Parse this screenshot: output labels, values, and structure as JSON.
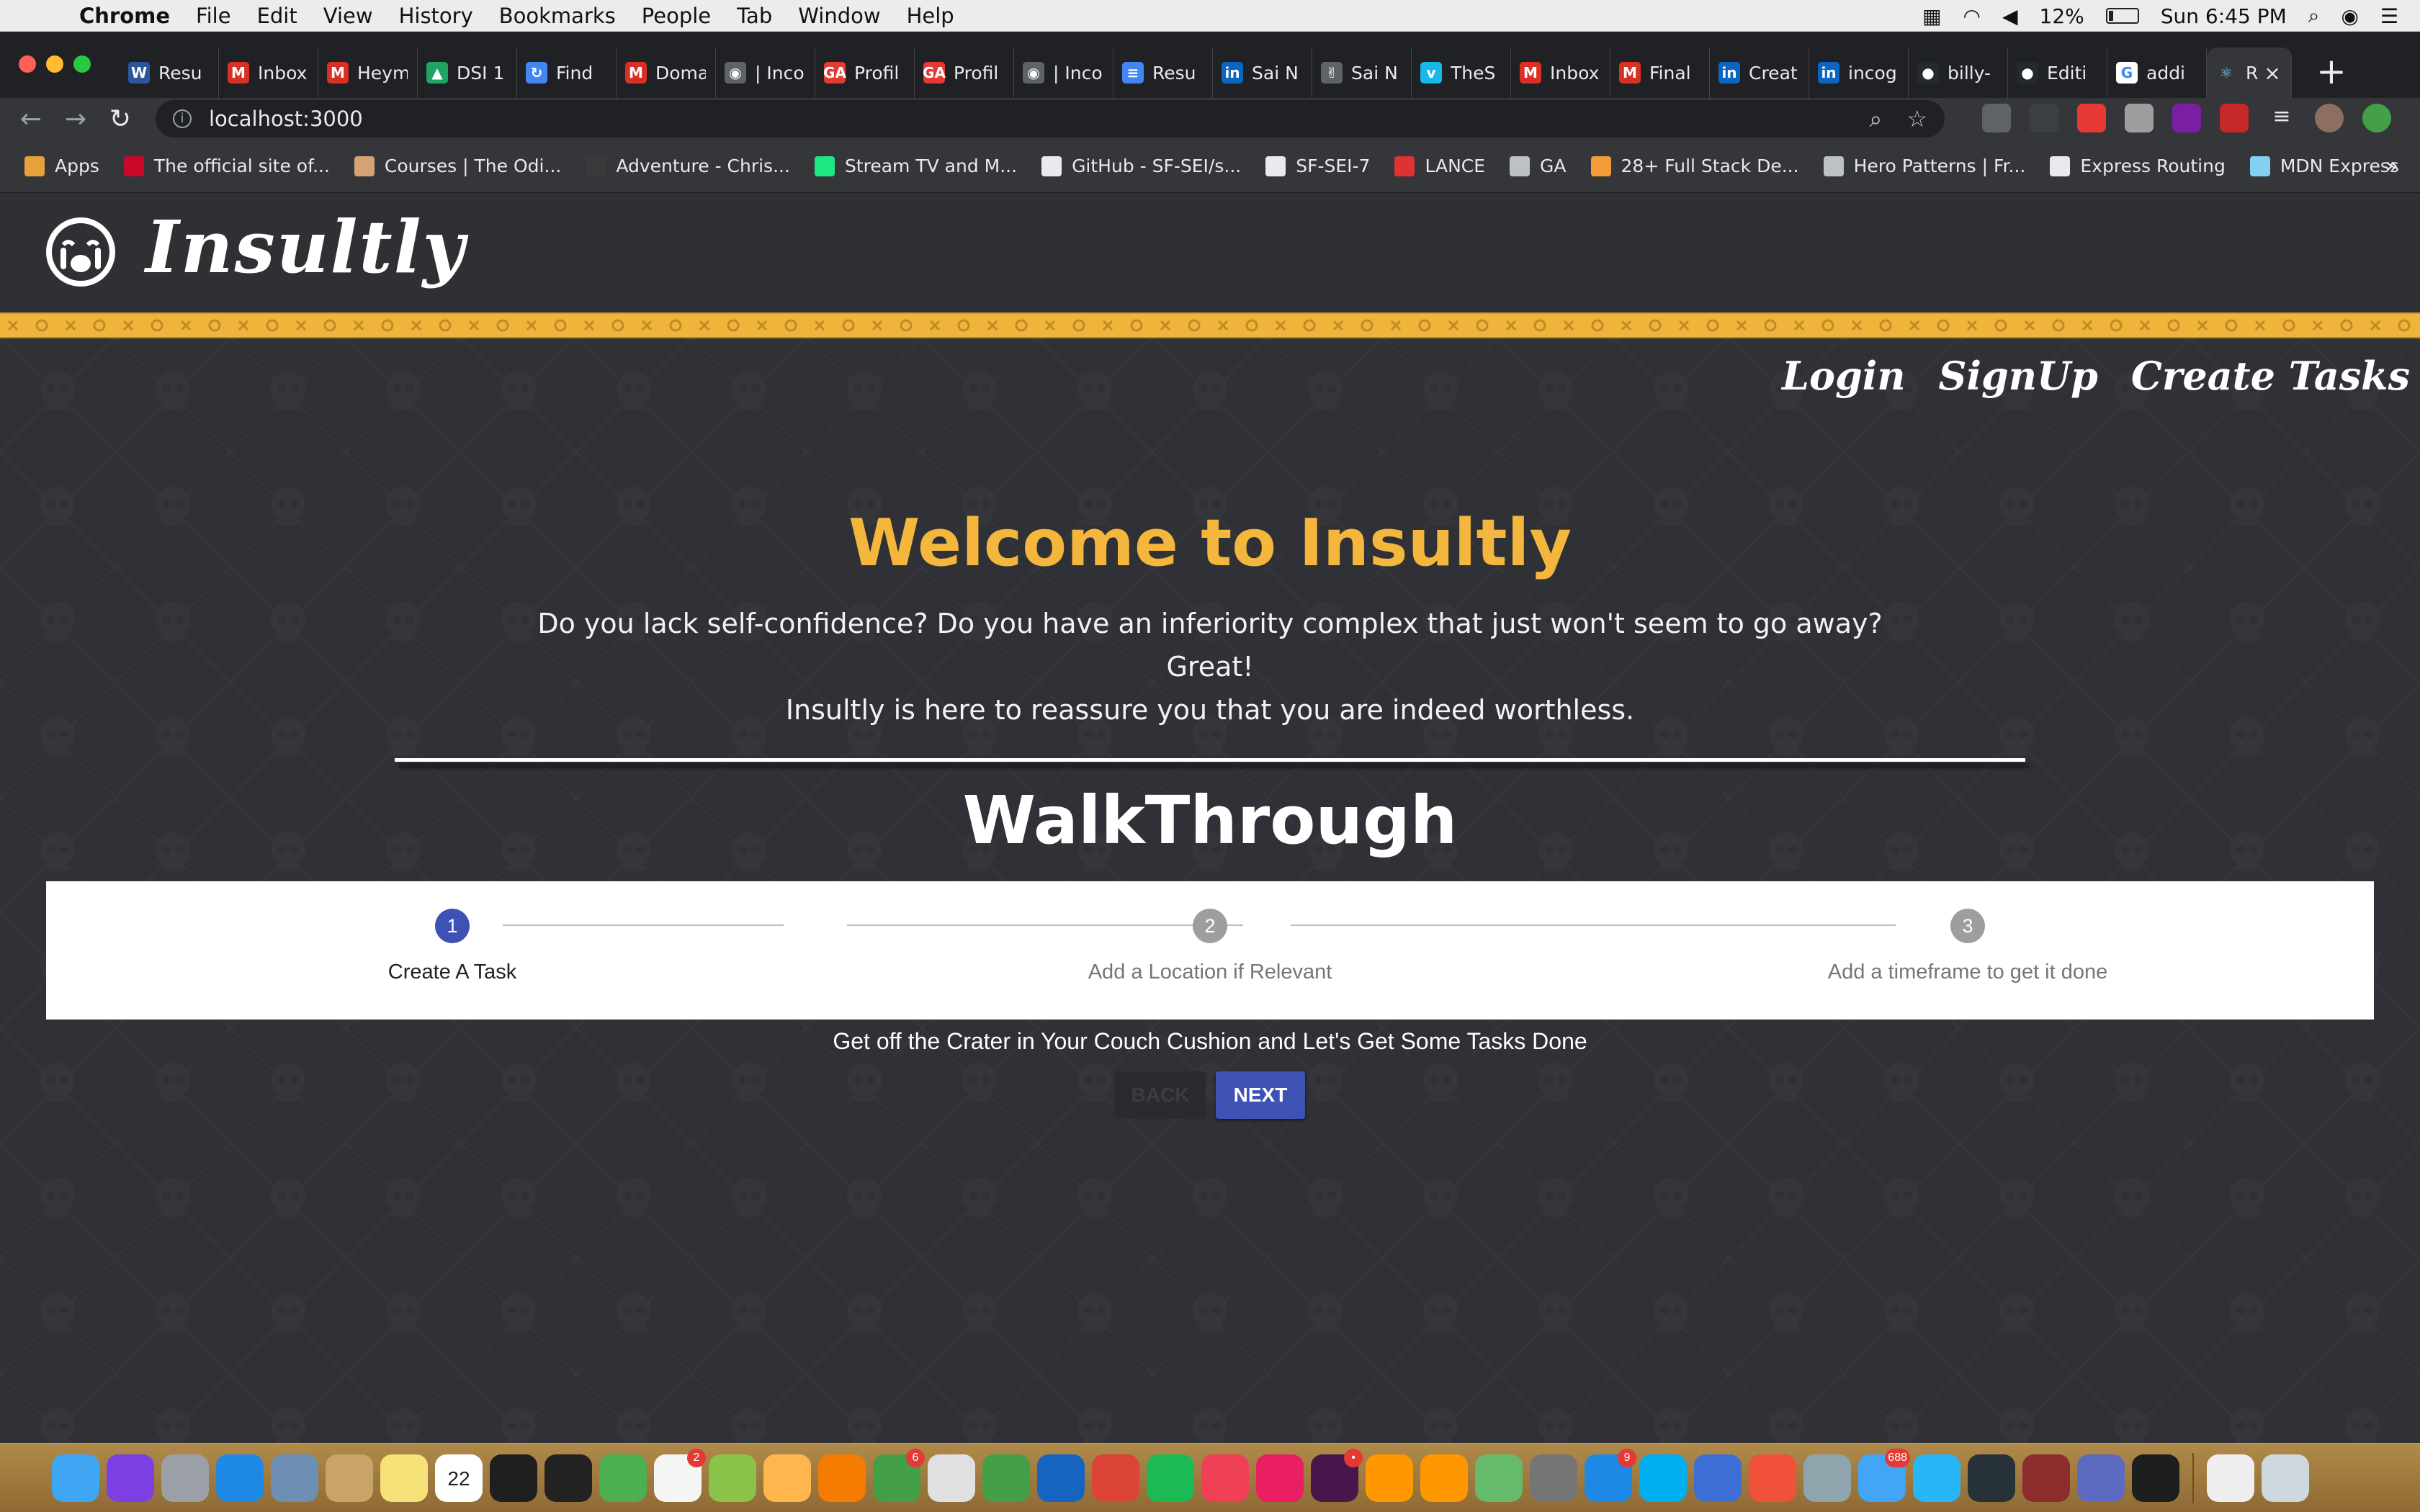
{
  "menubar": {
    "app": "Chrome",
    "items": [
      "File",
      "Edit",
      "View",
      "History",
      "Bookmarks",
      "People",
      "Tab",
      "Window",
      "Help"
    ],
    "battery": "12%",
    "clock": "Sun 6:45 PM"
  },
  "tabs": [
    {
      "title": "Resu",
      "icon": "word-doc-icon",
      "color": "#2b579a",
      "glyph": "W"
    },
    {
      "title": "Inbox",
      "icon": "gmail-icon",
      "color": "#d93025",
      "glyph": "M"
    },
    {
      "title": "Heym",
      "icon": "gmail-icon",
      "color": "#d93025",
      "glyph": "M"
    },
    {
      "title": "DSI 1",
      "icon": "google-drive-icon",
      "color": "#1fa463",
      "glyph": "▲"
    },
    {
      "title": "Find",
      "icon": "loading-spinner-icon",
      "color": "#4285f4",
      "glyph": "↻"
    },
    {
      "title": "Doma",
      "icon": "gmail-icon",
      "color": "#d93025",
      "glyph": "M"
    },
    {
      "title": "| Inco",
      "icon": "incognito-icon",
      "color": "#5f6368",
      "glyph": "◉"
    },
    {
      "title": "Profil",
      "icon": "ga-icon",
      "color": "#e53935",
      "glyph": "GA"
    },
    {
      "title": "Profil",
      "icon": "ga-icon",
      "color": "#e53935",
      "glyph": "GA"
    },
    {
      "title": "| Inco",
      "icon": "incognito-icon",
      "color": "#5f6368",
      "glyph": "◉"
    },
    {
      "title": "Resu",
      "icon": "google-docs-icon",
      "color": "#4285f4",
      "glyph": "≡"
    },
    {
      "title": "Sai N",
      "icon": "linkedin-icon",
      "color": "#0a66c2",
      "glyph": "in"
    },
    {
      "title": "Sai N",
      "icon": "hand-icon",
      "color": "#5f6368",
      "glyph": "✌"
    },
    {
      "title": "TheS",
      "icon": "vimeo-icon",
      "color": "#1ab7ea",
      "glyph": "v"
    },
    {
      "title": "Inbox",
      "icon": "gmail-icon",
      "color": "#d93025",
      "glyph": "M"
    },
    {
      "title": "Final",
      "icon": "gmail-icon",
      "color": "#d93025",
      "glyph": "M"
    },
    {
      "title": "Creat",
      "icon": "linkedin-icon",
      "color": "#0a66c2",
      "glyph": "in"
    },
    {
      "title": "incog",
      "icon": "linkedin-icon",
      "color": "#0a66c2",
      "glyph": "in"
    },
    {
      "title": "billy-",
      "icon": "github-icon",
      "color": "#24292e",
      "glyph": "●"
    },
    {
      "title": "Editi",
      "icon": "github-icon",
      "color": "#24292e",
      "glyph": "●"
    },
    {
      "title": "addi",
      "icon": "google-icon",
      "color": "#ffffff",
      "glyph": "G"
    }
  ],
  "active_tab": {
    "title": "R",
    "icon": "react-icon",
    "color": "#61dafb",
    "glyph": "⚛"
  },
  "toolbar": {
    "url": "localhost:3000"
  },
  "bookmarks": [
    {
      "label": "Apps",
      "icon": "apps-grid-icon",
      "color": "#e8a03a"
    },
    {
      "label": "The official site of...",
      "icon": "nba-icon",
      "color": "#c9082a"
    },
    {
      "label": "Courses | The Odi...",
      "icon": "odin-icon",
      "color": "#d4a373"
    },
    {
      "label": "Adventure - Chris...",
      "icon": "globe-icon",
      "color": "#3a3a3a"
    },
    {
      "label": "Stream TV and M...",
      "icon": "hulu-icon",
      "color": "#1ce783"
    },
    {
      "label": "GitHub - SF-SEI/s...",
      "icon": "github-icon",
      "color": "#e8eaed"
    },
    {
      "label": "SF-SEI-7",
      "icon": "github-icon",
      "color": "#e8eaed"
    },
    {
      "label": "LANCE",
      "icon": "lance-icon",
      "color": "#d33"
    },
    {
      "label": "GA",
      "icon": "folder-icon",
      "color": "#bdc1c6"
    },
    {
      "label": "28+ Full Stack De...",
      "icon": "bookmark-icon",
      "color": "#f29b38"
    },
    {
      "label": "Hero Patterns | Fr...",
      "icon": "pattern-icon",
      "color": "#bdc1c6"
    },
    {
      "label": "Express Routing",
      "icon": "github-icon",
      "color": "#e8eaed"
    },
    {
      "label": "MDN Express",
      "icon": "mdn-icon",
      "color": "#83d0f2"
    }
  ],
  "site": {
    "brand": "Insultly",
    "nav": [
      "Login",
      "SignUp",
      "Create Tasks"
    ],
    "welcome": "Welcome to Insultly",
    "intro_line1": "Do you lack self-confidence? Do you have an inferiority complex that just won't seem to go away? Great!",
    "intro_line2": "Insultly is here to reassure you that you are indeed worthless.",
    "walkthrough_title": "WalkThrough",
    "steps": [
      {
        "number": "1",
        "label": "Create A Task",
        "active": true
      },
      {
        "number": "2",
        "label": "Add a Location if Relevant",
        "active": false
      },
      {
        "number": "3",
        "label": "Add a timeframe to get it done",
        "active": false
      }
    ],
    "step_text": "Get off the Crater in Your Couch Cushion and Let's Get Some Tasks Done",
    "back_label": "BACK",
    "next_label": "NEXT"
  },
  "colors": {
    "accent_gold": "#f4b63c",
    "stripe": "#f0b43c",
    "page_bg": "#2f3136",
    "primary_button": "#3f51b5",
    "step_active": "#3f51b5",
    "step_inactive": "#9e9e9e"
  },
  "dock": [
    {
      "name": "finder-icon",
      "color": "#3ea6f2"
    },
    {
      "name": "siri-icon",
      "color": "#7b3fe4"
    },
    {
      "name": "launchpad-icon",
      "color": "#9aa0a6"
    },
    {
      "name": "safari-icon",
      "color": "#1e88e5"
    },
    {
      "name": "preview-icon",
      "color": "#6d8fb3"
    },
    {
      "name": "contacts-icon",
      "color": "#c8a46b"
    },
    {
      "name": "notes-icon",
      "color": "#f7e27a"
    },
    {
      "name": "calendar-icon",
      "color": "#ffffff",
      "text": "22"
    },
    {
      "name": "activity-monitor-icon",
      "color": "#1f1f1f"
    },
    {
      "name": "instruments-icon",
      "color": "#222222"
    },
    {
      "name": "maps-send-icon",
      "color": "#4caf50"
    },
    {
      "name": "reminders-icon",
      "color": "#f5f5f5",
      "badge": "2"
    },
    {
      "name": "maps-icon",
      "color": "#8bc34a"
    },
    {
      "name": "photos-icon",
      "color": "#ffb74d"
    },
    {
      "name": "vlc-icon",
      "color": "#f57c00"
    },
    {
      "name": "facetime-icon",
      "color": "#43a047",
      "badge": "6"
    },
    {
      "name": "keynote-pages-icon",
      "color": "#e0e0e0"
    },
    {
      "name": "numbers-icon",
      "color": "#43a047"
    },
    {
      "name": "keynote-icon",
      "color": "#1565c0"
    },
    {
      "name": "chrome-icon",
      "color": "#db4437"
    },
    {
      "name": "spotify-icon",
      "color": "#1db954"
    },
    {
      "name": "pocket-icon",
      "color": "#ef4056"
    },
    {
      "name": "itunes-icon",
      "color": "#e91e63"
    },
    {
      "name": "slack-icon",
      "color": "#4a154b",
      "badge": "•"
    },
    {
      "name": "sublime-icon",
      "color": "#ff9800"
    },
    {
      "name": "ibooks-icon",
      "color": "#ff9800"
    },
    {
      "name": "atom-icon",
      "color": "#66bb6a"
    },
    {
      "name": "system-preferences-icon",
      "color": "#757575"
    },
    {
      "name": "app-store-icon",
      "color": "#1e88e5",
      "badge": "9"
    },
    {
      "name": "skype-icon",
      "color": "#00aff0"
    },
    {
      "name": "vudu-icon",
      "color": "#3b6fd6"
    },
    {
      "name": "swift-playgrounds-icon",
      "color": "#f05138"
    },
    {
      "name": "image-capture-icon",
      "color": "#90a4ae"
    },
    {
      "name": "messages-icon",
      "color": "#42a5f5",
      "badge": "688"
    },
    {
      "name": "telegram-icon",
      "color": "#29b6f6"
    },
    {
      "name": "activity-icon",
      "color": "#263238"
    },
    {
      "name": "dictionary-icon",
      "color": "#8d2c2c"
    },
    {
      "name": "chrome-canary-icon",
      "color": "#5c6bc0"
    },
    {
      "name": "terminal-icon",
      "color": "#1e1e1e"
    },
    {
      "name": "documents-folder-icon",
      "color": "#eeeeee"
    },
    {
      "name": "trash-icon",
      "color": "#cfd8dc"
    }
  ]
}
